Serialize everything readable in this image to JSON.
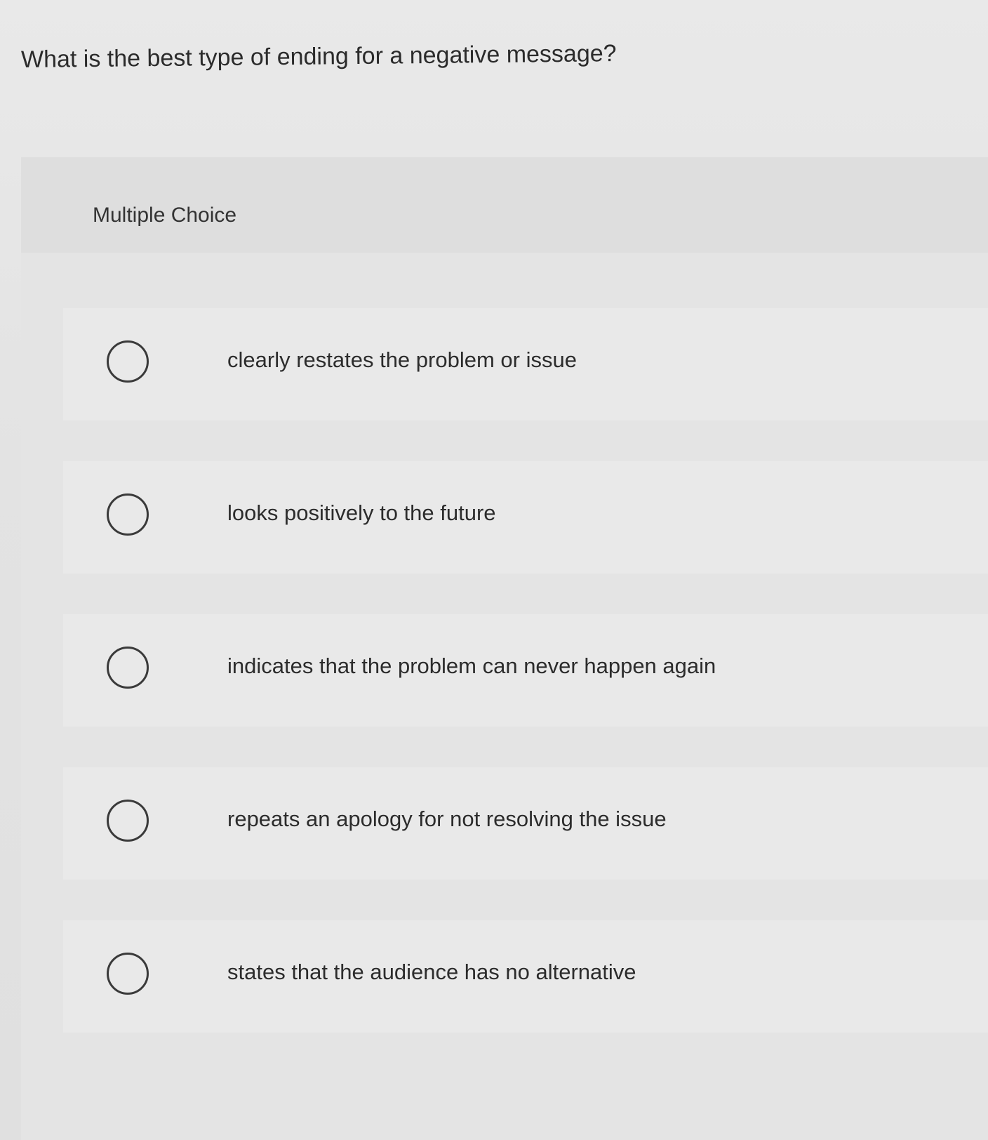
{
  "question": {
    "text": "What is the best type of ending for a negative message?"
  },
  "panel": {
    "type_label": "Multiple Choice"
  },
  "options": [
    {
      "label": "clearly restates the problem or issue"
    },
    {
      "label": "looks positively to the future"
    },
    {
      "label": "indicates that the problem can never happen again"
    },
    {
      "label": "repeats an apology for not resolving the issue"
    },
    {
      "label": "states that the audience has no alternative"
    }
  ]
}
